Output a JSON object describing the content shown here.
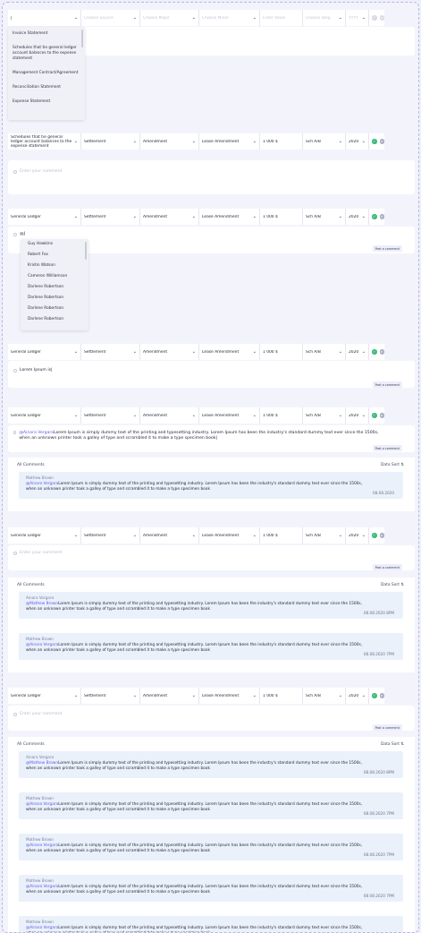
{
  "placeholders": {
    "source": "Choose Source",
    "major": "Choose Major",
    "minor": "Choose Minor",
    "value": "Enter Value",
    "step": "Choose Step",
    "year": "YYYY",
    "comment": "Enter your comment"
  },
  "row1_dropdown": [
    "Invoice Statement",
    "Schedules that tie general ledger account balances to the expense statement",
    "Management Contract/Agreement",
    "Reconciliation Statement",
    "Expense Statement"
  ],
  "row2": {
    "doc": "Schedules that tie general ledger account balances to the expense statement",
    "source": "Settlement",
    "major": "Amendment",
    "minor": "Lease Amendment",
    "value": "1 000 $",
    "step": "Sch A/B",
    "year": "2020"
  },
  "std": {
    "doc": "General Ledger",
    "source": "Settlement",
    "major": "Amendment",
    "minor": "Lease Amendment",
    "value": "1 000 $",
    "step": "Sch A/B",
    "year": "2020"
  },
  "mention_text": "@J",
  "people": [
    "Guy Hawkins",
    "Robert Fox",
    "Kristin Watson",
    "Cameron Williamson",
    "Darlene Robertson",
    "Darlene Robertson",
    "Darlene Robertson",
    "Darlene Robertson"
  ],
  "post_label": "Post a comment",
  "row4_comment": "Lorem Ipsum is|",
  "row5_comment_mention": "@Ainara Vergara",
  "row5_comment_text": "Lorem Ipsum is simply dummy text of the printing and typesetting industry. Lorem Ipsum has been the industry's standard dummy text ever since the 1500s, when an unknown printer took a galley of type and scrambled it to make a type specimen book|",
  "all_comments": "All Comments",
  "data_sort": "Data Sort",
  "sort_icon": "sort-icon",
  "body": "Lorem Ipsum is simply dummy text of the printing and typesetting industry. Lorem Ipsum has been the industry's standard dummy text ever since the 1500s, when an unknown printer took a galley of type and scrambled it to make a type specimen book",
  "row5_msgs": [
    {
      "author": "Mathew Brown",
      "mention": "@Ainara Vergara",
      "date": "08.08.2020"
    }
  ],
  "row6_msgs": [
    {
      "author": "Ainara Vergara",
      "mention": "@Mathew Brown",
      "date": "08.08.2020 8PM"
    },
    {
      "author": "Mathew Brown",
      "mention": "@Ainara Vergara",
      "date": "08.08.2020 7PM"
    }
  ],
  "row7_msgs": [
    {
      "author": "Ainara Vergara",
      "mention": "@Mathew Brown",
      "date": "08.08.2020 8PM"
    },
    {
      "author": "Mathew Brown",
      "mention": "@Ainara Vergara",
      "date": "08.08.2020 7PM"
    },
    {
      "author": "Mathew Brown",
      "mention": "@Ainara Vergara",
      "date": "08.08.2020 7PM"
    },
    {
      "author": "Mathew Brown",
      "mention": "@Ainara Vergara",
      "date": "08.08.2020 7PM"
    },
    {
      "author": "Mathew Brown",
      "mention": "@Ainara Vergara",
      "date": ""
    }
  ],
  "colors": {
    "accent": "#5b5ce8",
    "approve": "#3dbb7c",
    "reject": "#a8adbf",
    "comment_bg": "#eaf1fb"
  }
}
